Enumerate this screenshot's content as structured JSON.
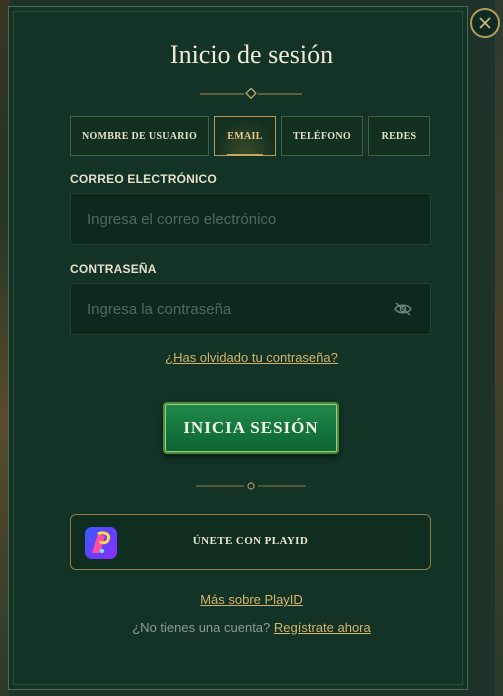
{
  "title": "Inicio de sesión",
  "tabs": [
    {
      "label": "NOMBRE DE USUARIO",
      "active": false
    },
    {
      "label": "EMAIL",
      "active": true
    },
    {
      "label": "TELÉFONO",
      "active": false
    },
    {
      "label": "REDES",
      "active": false
    }
  ],
  "email": {
    "label": "CORREO ELECTRÓNICO",
    "placeholder": "Ingresa el correo electrónico",
    "value": ""
  },
  "password": {
    "label": "CONTRASEÑA",
    "placeholder": "Ingresa la contraseña",
    "value": ""
  },
  "forgot_link": "¿Has olvidado tu contraseña?",
  "submit_label": "INICIA SESIÓN",
  "playid": {
    "label": "ÚNETE CON PLAYID",
    "more_link": "Más sobre PlayID"
  },
  "signup": {
    "prompt": "¿No tienes una cuenta?",
    "link": "Regístrate ahora"
  },
  "icons": {
    "close": "close-icon",
    "password_visibility": "eye-off-icon",
    "playid_logo": "playid-logo-icon"
  },
  "colors": {
    "panel": "#133327",
    "accent_gold": "#d4b469",
    "button_green": "#1f8a49",
    "playid_purple": "#6a3dff"
  }
}
